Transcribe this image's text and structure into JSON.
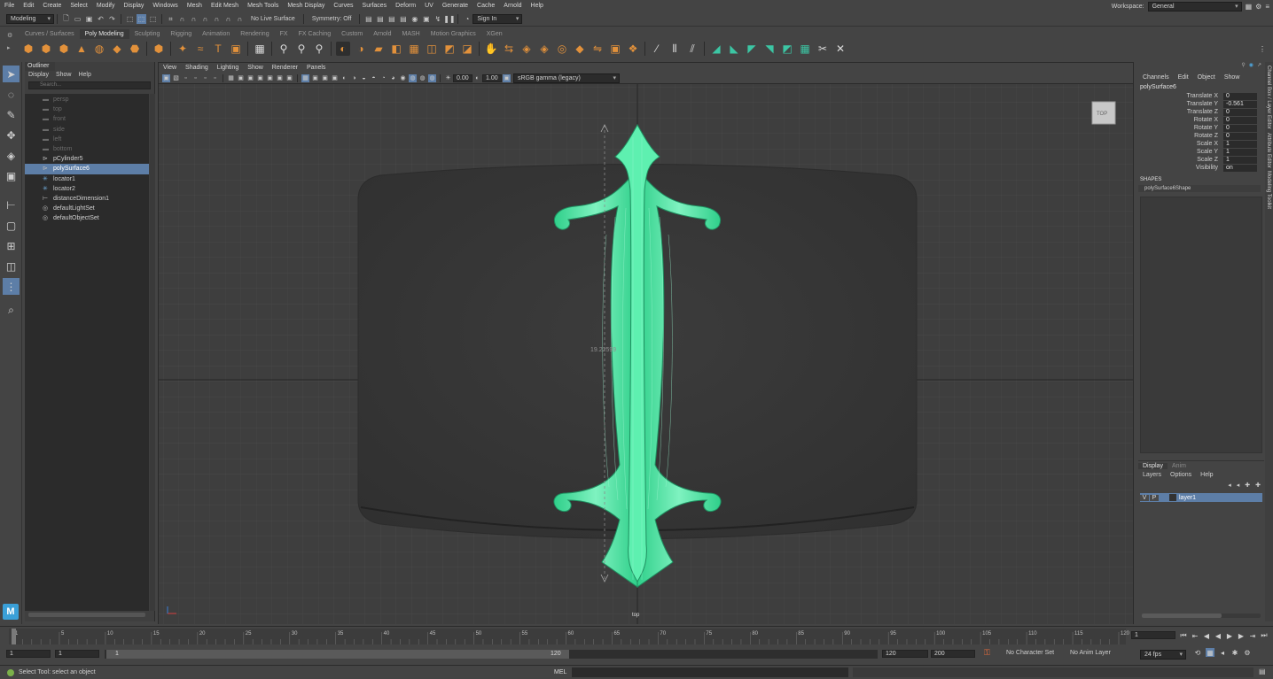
{
  "menu": [
    "File",
    "Edit",
    "Create",
    "Select",
    "Modify",
    "Display",
    "Windows",
    "Mesh",
    "Edit Mesh",
    "Mesh Tools",
    "Mesh Display",
    "Curves",
    "Surfaces",
    "Deform",
    "UV",
    "Generate",
    "Cache",
    "Arnold",
    "Help"
  ],
  "workspace": {
    "label": "Workspace:",
    "value": "General"
  },
  "status": {
    "mode": "Modeling",
    "live_surface": "No Live Surface",
    "symmetry": "Symmetry: Off",
    "sign_in": "Sign In"
  },
  "shelf_tabs": [
    "Curves / Surfaces",
    "Poly Modeling",
    "Sculpting",
    "Rigging",
    "Animation",
    "Rendering",
    "FX",
    "FX Caching",
    "Custom",
    "Arnold",
    "MASH",
    "Motion Graphics",
    "XGen"
  ],
  "shelf_active": "Poly Modeling",
  "outliner": {
    "title": "Outliner",
    "menu": [
      "Display",
      "Show",
      "Help"
    ],
    "search_placeholder": "Search...",
    "items": [
      {
        "label": "persp",
        "kind": "camera",
        "dim": true
      },
      {
        "label": "top",
        "kind": "camera",
        "dim": true
      },
      {
        "label": "front",
        "kind": "camera",
        "dim": true
      },
      {
        "label": "side",
        "kind": "camera",
        "dim": true
      },
      {
        "label": "left",
        "kind": "camera",
        "dim": true
      },
      {
        "label": "bottom",
        "kind": "camera",
        "dim": true
      },
      {
        "label": "pCylinder5",
        "kind": "mesh"
      },
      {
        "label": "polySurface6",
        "kind": "mesh",
        "selected": true
      },
      {
        "label": "locator1",
        "kind": "locator"
      },
      {
        "label": "locator2",
        "kind": "locator"
      },
      {
        "label": "distanceDimension1",
        "kind": "dimension"
      },
      {
        "label": "defaultLightSet",
        "kind": "set"
      },
      {
        "label": "defaultObjectSet",
        "kind": "set"
      }
    ]
  },
  "viewport": {
    "menu": [
      "View",
      "Shading",
      "Lighting",
      "Show",
      "Renderer",
      "Panels"
    ],
    "exposure": "0.00",
    "gamma": "1.00",
    "color_space": "sRGB gamma (legacy)",
    "view_cube": "TOP",
    "camera_label": "top",
    "dimension_value": "19.22599"
  },
  "channelbox": {
    "menu": [
      "Channels",
      "Edit",
      "Object",
      "Show"
    ],
    "object": "polySurface6",
    "attributes": [
      {
        "label": "Translate X",
        "value": "0"
      },
      {
        "label": "Translate Y",
        "value": "-0.561"
      },
      {
        "label": "Translate Z",
        "value": "0"
      },
      {
        "label": "Rotate X",
        "value": "0"
      },
      {
        "label": "Rotate Y",
        "value": "0"
      },
      {
        "label": "Rotate Z",
        "value": "0"
      },
      {
        "label": "Scale X",
        "value": "1"
      },
      {
        "label": "Scale Y",
        "value": "1"
      },
      {
        "label": "Scale Z",
        "value": "1"
      },
      {
        "label": "Visibility",
        "value": "on"
      }
    ],
    "shapes_heading": "SHAPES",
    "shape_name": "polySurface6Shape"
  },
  "side_tabs": [
    "Channel Box / Layer Editor",
    "Attribute Editor",
    "Modeling Toolkit"
  ],
  "layers": {
    "tabs": [
      "Display",
      "Anim"
    ],
    "menu": [
      "Layers",
      "Options",
      "Help"
    ],
    "layer": {
      "v": "V",
      "p": "P",
      "name": "layer1"
    }
  },
  "timeline": {
    "ticks": [
      "1",
      "5",
      "10",
      "15",
      "20",
      "25",
      "30",
      "35",
      "40",
      "45",
      "50",
      "55",
      "60",
      "65",
      "70",
      "75",
      "80",
      "85",
      "90",
      "95",
      "100",
      "105",
      "110",
      "115",
      "120"
    ],
    "current_frame": "1",
    "range_start": "1",
    "range_start2": "1",
    "range_bar_start": "1",
    "range_bar_end": "120",
    "range_end": "120",
    "anim_end": "200",
    "character_set": "No Character Set",
    "anim_layer": "No Anim Layer",
    "fps": "24 fps"
  },
  "command": {
    "lang": "MEL",
    "help": "Select Tool: select an object"
  },
  "colors": {
    "accent": "#5d7ea7",
    "wire": "#3ddf9a",
    "shelf_orange": "#e2913b"
  }
}
